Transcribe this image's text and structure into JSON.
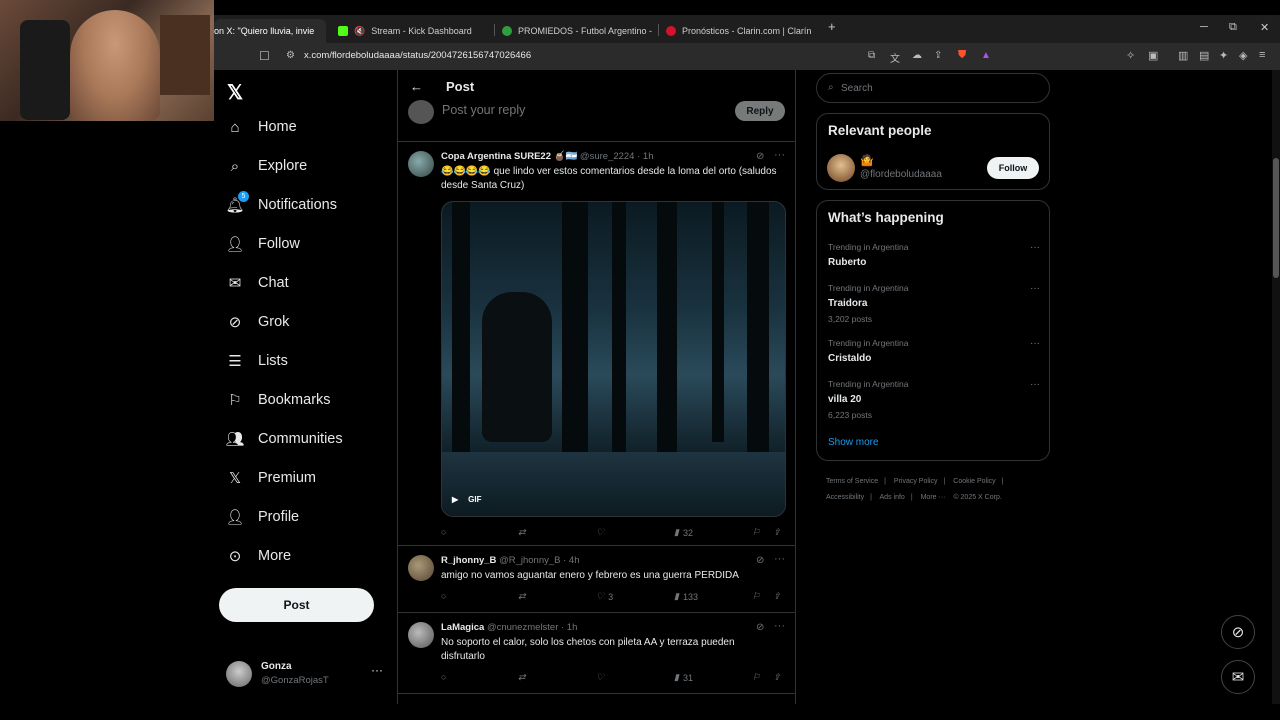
{
  "browser": {
    "tabs": [
      {
        "label": "on X: \"Quiero lluvia, invie",
        "active": true,
        "color": "#000000"
      },
      {
        "label": "Stream - Kick Dashboard",
        "active": false,
        "color": "#53fc18"
      },
      {
        "label": "PROMIEDOS - Futbol Argentino - Fix",
        "active": false,
        "color": "#2e9e3e"
      },
      {
        "label": "Pronósticos - Clarin.com | Clarín",
        "active": false,
        "color": "#d4122d"
      }
    ],
    "url": "x.com/flordeboludaaaa/status/2004726156747026466"
  },
  "nav": {
    "items": [
      {
        "label": "Home",
        "icon": "home-icon"
      },
      {
        "label": "Explore",
        "icon": "search-icon"
      },
      {
        "label": "Notifications",
        "icon": "bell-icon",
        "badge": "5"
      },
      {
        "label": "Follow",
        "icon": "add-person-icon"
      },
      {
        "label": "Chat",
        "icon": "mail-icon"
      },
      {
        "label": "Grok",
        "icon": "grok-icon"
      },
      {
        "label": "Lists",
        "icon": "list-icon"
      },
      {
        "label": "Bookmarks",
        "icon": "bookmark-icon"
      },
      {
        "label": "Communities",
        "icon": "people-icon"
      },
      {
        "label": "Premium",
        "icon": "x-logo-icon"
      },
      {
        "label": "Profile",
        "icon": "person-icon"
      },
      {
        "label": "More",
        "icon": "more-circle-icon"
      }
    ],
    "post_button": "Post",
    "account": {
      "name": "Gonza",
      "handle": "@GonzaRojasT"
    }
  },
  "main": {
    "header_title": "Post",
    "compose_placeholder": "Post your reply",
    "reply_button": "Reply",
    "tweets": [
      {
        "name": "Copa Argentina SURE22 🧉🇦🇷",
        "handle": "@sure_2224 · 1h",
        "text": "😂😂😂😂 que lindo ver estos comentarios desde la loma del orto (saludos desde Santa Cruz)",
        "media_label": "GIF",
        "replies": "",
        "reposts": "",
        "likes": "",
        "views": "32"
      },
      {
        "name": "R_jhonny_B",
        "handle": "@R_jhonny_B · 4h",
        "text": "amigo no vamos aguantar enero y febrero es una guerra PERDIDA",
        "replies": "",
        "reposts": "",
        "likes": "3",
        "views": "133"
      },
      {
        "name": "LaMagica",
        "handle": "@cnunezmelster · 1h",
        "text": "No soporto el calor, solo los chetos con pileta AA y terraza pueden disfrutarlo",
        "replies": "",
        "reposts": "",
        "likes": "",
        "views": "31"
      }
    ]
  },
  "right": {
    "search_placeholder": "Search",
    "relevant_title": "Relevant people",
    "relevant_person": {
      "emoji": "🤷",
      "handle": "@flordeboludaaaa",
      "follow": "Follow"
    },
    "happening_title": "What’s happening",
    "trends": [
      {
        "context": "Trending in Argentina",
        "name": "Ruberto",
        "count": ""
      },
      {
        "context": "Trending in Argentina",
        "name": "Traidora",
        "count": "3,202 posts"
      },
      {
        "context": "Trending in Argentina",
        "name": "Cristaldo",
        "count": ""
      },
      {
        "context": "Trending in Argentina",
        "name": "villa 20",
        "count": "6,223 posts"
      }
    ],
    "show_more": "Show more",
    "footer": [
      "Terms of Service",
      "|",
      "Privacy Policy",
      "|",
      "Cookie Policy",
      "|",
      "Accessibility",
      "|",
      "Ads info",
      "|",
      "More ···",
      "© 2025 X Corp."
    ]
  }
}
